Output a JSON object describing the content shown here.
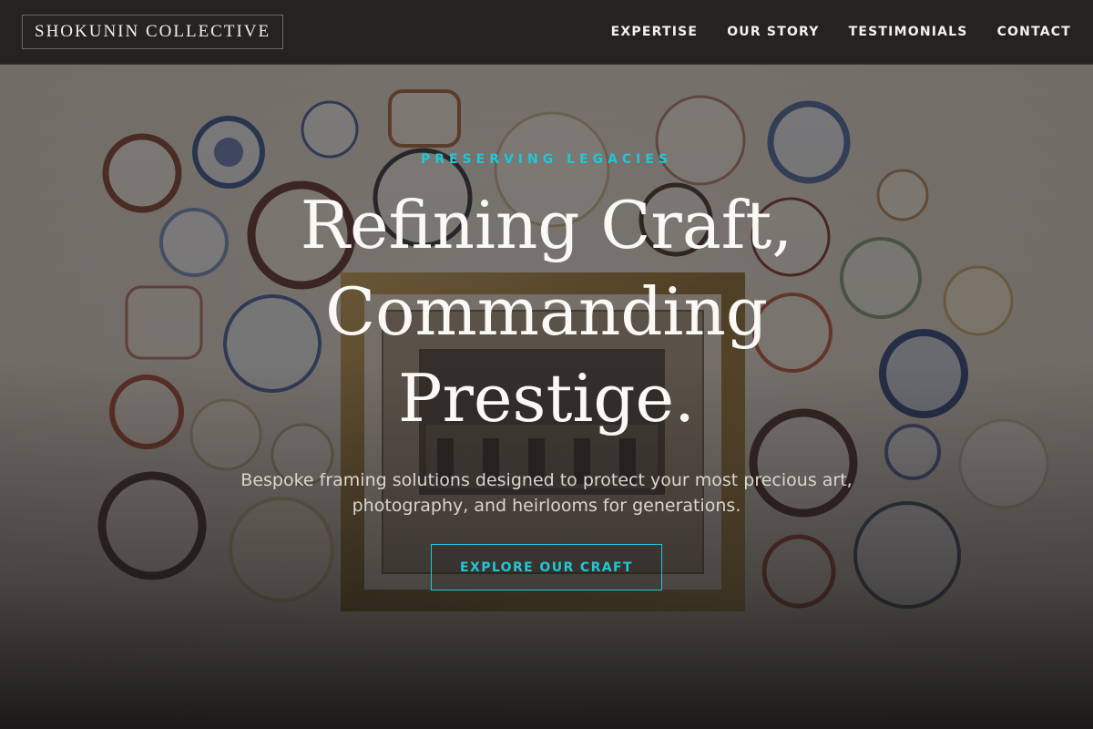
{
  "header": {
    "logo": "SHOKUNIN COLLECTIVE",
    "nav": [
      "EXPERTISE",
      "OUR STORY",
      "TESTIMONIALS",
      "CONTACT"
    ]
  },
  "hero": {
    "eyebrow": "PRESERVING LEGACIES",
    "headline": [
      "Refining Craft,",
      "Commanding",
      "Prestige."
    ],
    "subtitle_lines": [
      "Bespoke framing solutions designed to protect your most precious art,",
      "photography, and heirlooms for generations."
    ],
    "cta": "EXPLORE OUR CRAFT"
  },
  "colors": {
    "accent": "#1ec8d8",
    "header_bg": "#252322",
    "text_light": "#fbf9f5"
  }
}
